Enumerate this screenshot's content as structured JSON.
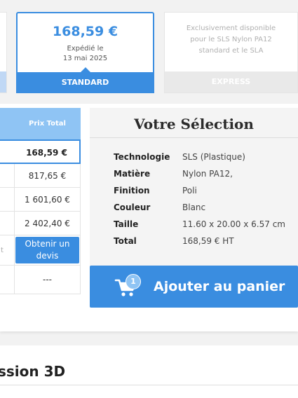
{
  "shipping": {
    "standard": {
      "price": "168,59 €",
      "ship_line1": "Expédié le",
      "ship_line2": "13 mai 2025",
      "label": "STANDARD"
    },
    "express": {
      "note_line1": "Exclusivement disponible",
      "note_line2": "pour le SLS Nylon PA12",
      "note_line3": "standard et le SLA",
      "label": "EXPRESS"
    }
  },
  "price_table": {
    "header": "Prix Total",
    "rows": [
      {
        "value": "168,59 €",
        "selected": true
      },
      {
        "value": "817,65 €"
      },
      {
        "value": "1 601,60 €"
      },
      {
        "value": "2 402,40 €"
      },
      {
        "fragment": "t",
        "button": "Obtenir un devis"
      },
      {
        "value": "---"
      }
    ]
  },
  "selection": {
    "title": "Votre Sélection",
    "specs": [
      {
        "key": "Technologie",
        "value": "SLS (Plastique)"
      },
      {
        "key": "Matière",
        "value": "Nylon PA12,"
      },
      {
        "key": "Finition",
        "value": "Poli"
      },
      {
        "key": "Couleur",
        "value": "Blanc"
      },
      {
        "key": "Taille",
        "value": "11.60 x 20.00 x 6.57 cm"
      },
      {
        "key": "Total",
        "value": "168,59 € HT"
      }
    ],
    "cart_button": "Ajouter au panier",
    "cart_badge": "1",
    "cart_icon": "cart-icon"
  },
  "footer": {
    "section_title": "ssion 3D"
  },
  "colors": {
    "accent": "#3a8de0",
    "accent_light": "#8fc4f4",
    "muted": "#e9e9e9"
  }
}
